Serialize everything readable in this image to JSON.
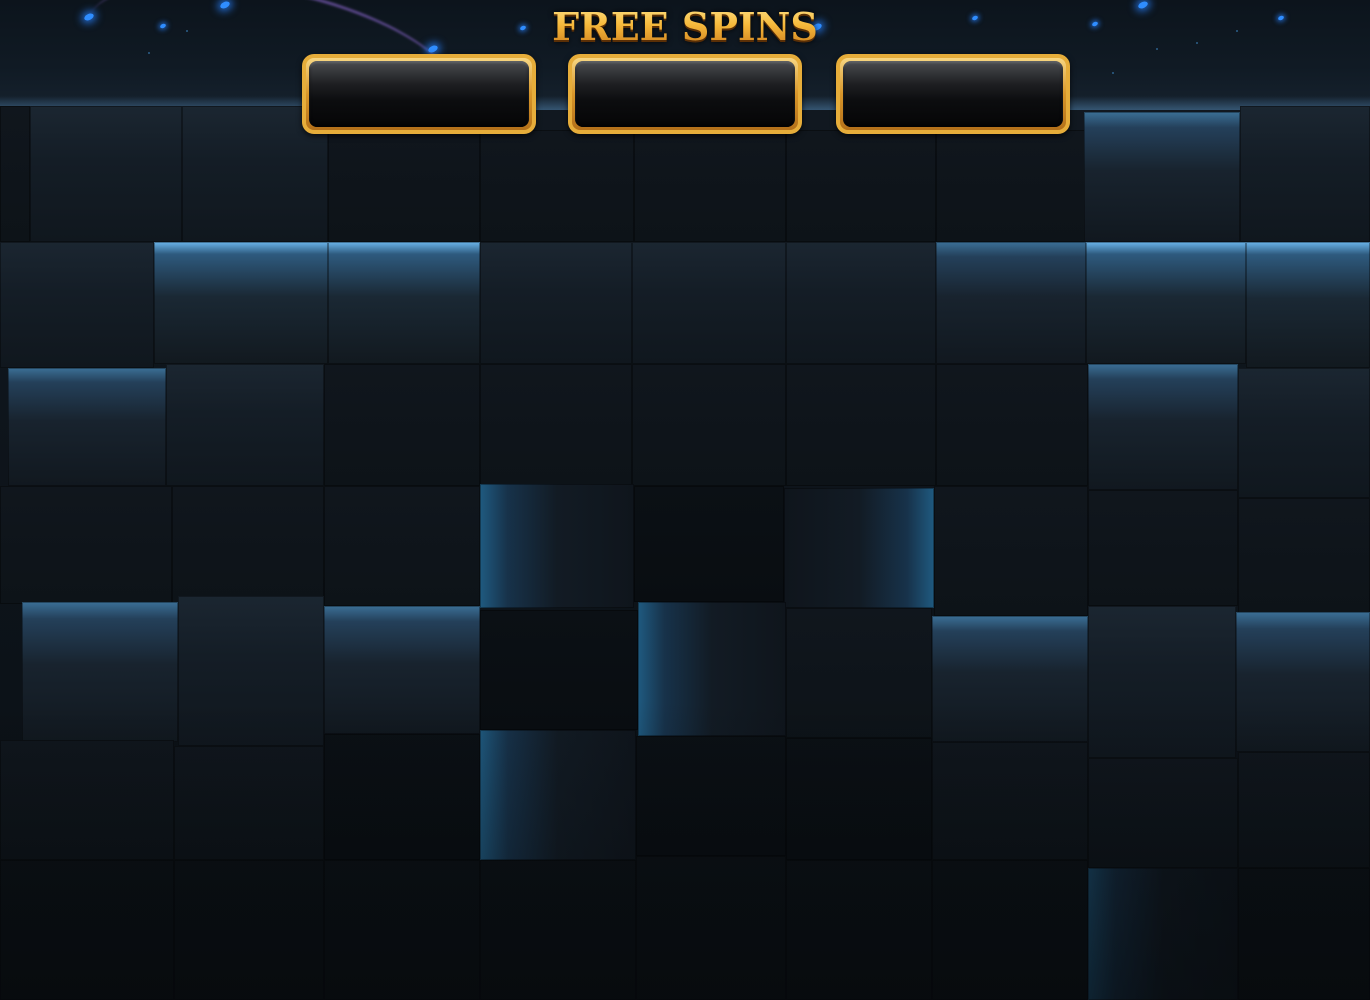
{
  "title": "FREE SPINS",
  "counters": [
    {
      "name": "counter-1",
      "value": ""
    },
    {
      "name": "counter-2",
      "value": ""
    },
    {
      "name": "counter-3",
      "value": ""
    }
  ],
  "colors": {
    "title_gold": "#f6b93b",
    "frame_gold": "#e6ad3a",
    "glow_blue": "#2f8dff",
    "background": "#0f161d"
  }
}
